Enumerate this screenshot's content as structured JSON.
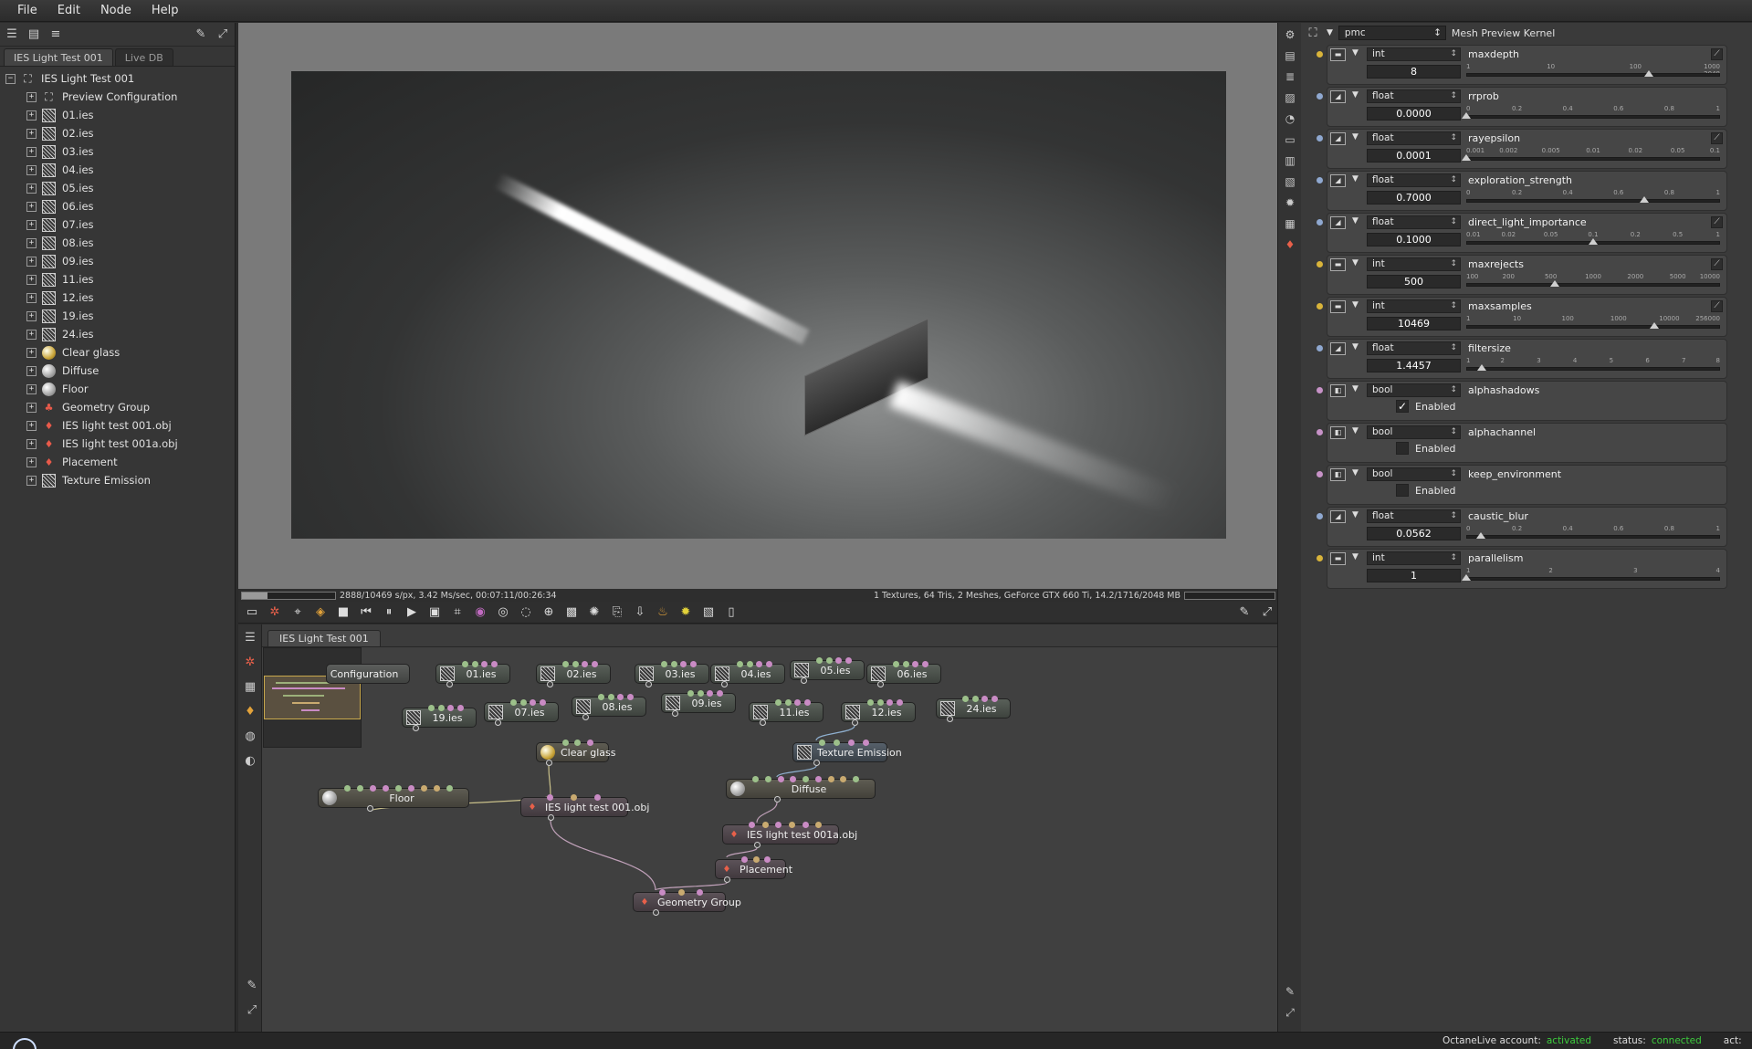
{
  "menu": [
    "File",
    "Edit",
    "Node",
    "Help"
  ],
  "left_panel": {
    "tabs": [
      "IES Light Test 001",
      "Live DB"
    ],
    "root": "IES Light Test 001",
    "items": [
      {
        "label": "Preview Configuration",
        "icon": "config-icon"
      },
      {
        "label": "01.ies",
        "icon": "texture-icon"
      },
      {
        "label": "02.ies",
        "icon": "texture-icon"
      },
      {
        "label": "03.ies",
        "icon": "texture-icon"
      },
      {
        "label": "04.ies",
        "icon": "texture-icon"
      },
      {
        "label": "05.ies",
        "icon": "texture-icon"
      },
      {
        "label": "06.ies",
        "icon": "texture-icon"
      },
      {
        "label": "07.ies",
        "icon": "texture-icon"
      },
      {
        "label": "08.ies",
        "icon": "texture-icon"
      },
      {
        "label": "09.ies",
        "icon": "texture-icon"
      },
      {
        "label": "11.ies",
        "icon": "texture-icon"
      },
      {
        "label": "12.ies",
        "icon": "texture-icon"
      },
      {
        "label": "19.ies",
        "icon": "texture-icon"
      },
      {
        "label": "24.ies",
        "icon": "texture-icon"
      },
      {
        "label": "Clear glass",
        "icon": "glass-material-icon"
      },
      {
        "label": "Diffuse",
        "icon": "diffuse-material-icon"
      },
      {
        "label": "Floor",
        "icon": "diffuse-material-icon"
      },
      {
        "label": "Geometry Group",
        "icon": "geometry-icon"
      },
      {
        "label": "IES light test 001.obj",
        "icon": "mesh-icon"
      },
      {
        "label": "IES light test 001a.obj",
        "icon": "mesh-icon"
      },
      {
        "label": "Placement",
        "icon": "placement-icon"
      },
      {
        "label": "Texture Emission",
        "icon": "emission-icon"
      }
    ]
  },
  "status": {
    "progress": 0.276,
    "left": "2888/10469 s/px, 3.42 Ms/sec, 00:07:11/00:26:34",
    "right": "1 Textures, 64 Tris, 2 Meshes, GeForce GTX 660 Ti, 14.2/1716/2048 MB"
  },
  "graph": {
    "tab": "IES Light Test 001",
    "nodes": [
      {
        "label": "Configuration",
        "kind": "cfg"
      },
      {
        "label": "01.ies",
        "kind": "tex"
      },
      {
        "label": "02.ies",
        "kind": "tex"
      },
      {
        "label": "03.ies",
        "kind": "tex"
      },
      {
        "label": "04.ies",
        "kind": "tex"
      },
      {
        "label": "05.ies",
        "kind": "tex"
      },
      {
        "label": "06.ies",
        "kind": "tex"
      },
      {
        "label": "19.ies",
        "kind": "tex"
      },
      {
        "label": "07.ies",
        "kind": "tex"
      },
      {
        "label": "08.ies",
        "kind": "tex"
      },
      {
        "label": "09.ies",
        "kind": "tex"
      },
      {
        "label": "11.ies",
        "kind": "tex"
      },
      {
        "label": "12.ies",
        "kind": "tex"
      },
      {
        "label": "24.ies",
        "kind": "tex"
      },
      {
        "label": "Clear glass",
        "kind": "mat"
      },
      {
        "label": "Texture Emission",
        "kind": "emit"
      },
      {
        "label": "Floor",
        "kind": "mat"
      },
      {
        "label": "Diffuse",
        "kind": "mat"
      },
      {
        "label": "IES light test 001.obj",
        "kind": "geo"
      },
      {
        "label": "IES light test 001a.obj",
        "kind": "geo"
      },
      {
        "label": "Placement",
        "kind": "geo"
      },
      {
        "label": "Geometry Group",
        "kind": "geo"
      }
    ]
  },
  "kernel": {
    "combo": "pmc",
    "title": "Mesh Preview Kernel",
    "params": [
      {
        "type": "int",
        "name": "maxdepth",
        "value": "8",
        "ticks": [
          "1",
          "10",
          "100",
          "1000 2048"
        ],
        "level": 0.72,
        "dot": "#d9b43a"
      },
      {
        "type": "float",
        "name": "rrprob",
        "value": "0.0000",
        "ticks": [
          "0",
          "0.2",
          "0.4",
          "0.6",
          "0.8",
          "1"
        ],
        "level": 0.0,
        "dot": "#8fa8d0"
      },
      {
        "type": "float",
        "name": "rayepsilon",
        "value": "0.0001",
        "ticks": [
          "0.001",
          "0.002",
          "0.005",
          "0.01",
          "0.02",
          "0.05",
          "0.1"
        ],
        "level": 0.0,
        "dot": "#8fa8d0"
      },
      {
        "type": "float",
        "name": "exploration_strength",
        "value": "0.7000",
        "ticks": [
          "0",
          "0.2",
          "0.4",
          "0.6",
          "0.8",
          "1"
        ],
        "level": 0.7,
        "dot": "#8fa8d0"
      },
      {
        "type": "float",
        "name": "direct_light_importance",
        "value": "0.1000",
        "ticks": [
          "0.01",
          "0.02",
          "0.05",
          "0.1",
          "0.2",
          "0.5",
          "1"
        ],
        "level": 0.5,
        "dot": "#8fa8d0"
      },
      {
        "type": "int",
        "name": "maxrejects",
        "value": "500",
        "ticks": [
          "100",
          "200",
          "500",
          "1000",
          "2000",
          "5000",
          "10000"
        ],
        "level": 0.35,
        "dot": "#d9b43a"
      },
      {
        "type": "int",
        "name": "maxsamples",
        "value": "10469",
        "ticks": [
          "1",
          "10",
          "100",
          "1000",
          "10000",
          "256000"
        ],
        "level": 0.74,
        "dot": "#d9b43a"
      },
      {
        "type": "float",
        "name": "filtersize",
        "value": "1.4457",
        "ticks": [
          "1",
          "2",
          "3",
          "4",
          "5",
          "6",
          "7",
          "8"
        ],
        "level": 0.06,
        "dot": "#8fa8d0"
      },
      {
        "type": "bool",
        "name": "alphashadows",
        "check": "Enabled",
        "checked": true,
        "dot": "#c792c7"
      },
      {
        "type": "bool",
        "name": "alphachannel",
        "check": "Enabled",
        "checked": false,
        "dot": "#c792c7"
      },
      {
        "type": "bool",
        "name": "keep_environment",
        "check": "Enabled",
        "checked": false,
        "dot": "#c792c7"
      },
      {
        "type": "float",
        "name": "caustic_blur",
        "value": "0.0562",
        "ticks": [
          "0",
          "0.2",
          "0.4",
          "0.6",
          "0.8",
          "1"
        ],
        "level": 0.056,
        "dot": "#8fa8d0"
      },
      {
        "type": "int",
        "name": "parallelism",
        "value": "1",
        "ticks": [
          "1",
          "2",
          "3",
          "4"
        ],
        "level": 0.0,
        "dot": "#d9b43a"
      }
    ]
  },
  "footer": {
    "account_label": "OctaneLive account:",
    "account_value": "activated",
    "status_label": "status:",
    "status_value": "connected",
    "act_label": "act:"
  },
  "colors": {
    "accent_green": "#3dcc3d",
    "pin_green": "#9cc08a",
    "pin_pink": "#c98bc4",
    "pin_tan": "#c9aa70",
    "wire": "#bfa0b8"
  }
}
